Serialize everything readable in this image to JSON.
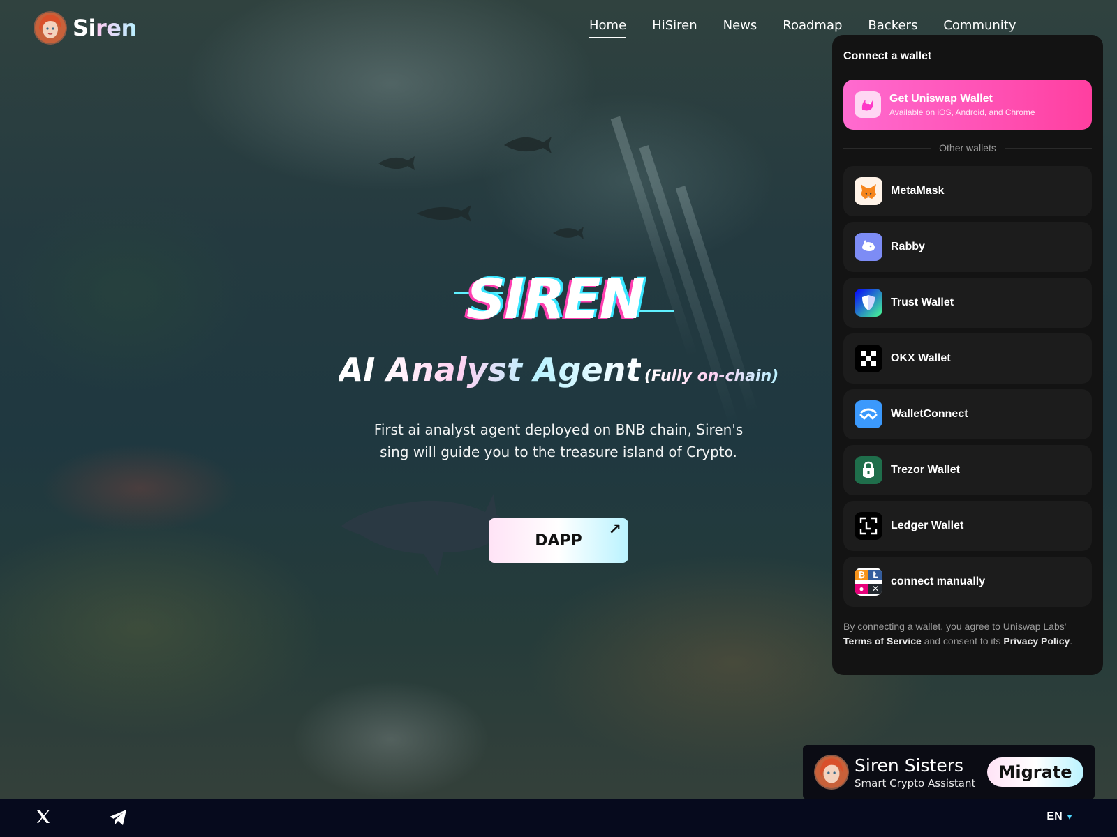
{
  "brand": {
    "name_start": "Si",
    "name_end": "ren"
  },
  "nav": {
    "items": [
      {
        "label": "Home",
        "active": true
      },
      {
        "label": "HiSiren",
        "active": false
      },
      {
        "label": "News",
        "active": false
      },
      {
        "label": "Roadmap",
        "active": false
      },
      {
        "label": "Backers",
        "active": false
      },
      {
        "label": "Community",
        "active": false
      }
    ]
  },
  "hero": {
    "logo_text": "SIREN",
    "title": "AI Analyst Agent",
    "title_suffix": "(Fully on-chain)",
    "description": "First ai analyst agent deployed on BNB chain, Siren's sing will guide you to the treasure island of Crypto.",
    "cta_label": "DAPP",
    "cta_icon": "arrow-up-right-icon"
  },
  "wallet_modal": {
    "title": "Connect a wallet",
    "featured": {
      "name": "Get Uniswap Wallet",
      "subtitle": "Available on iOS, Android, and Chrome",
      "icon": "uniswap-icon"
    },
    "divider_label": "Other wallets",
    "wallets": [
      {
        "name": "MetaMask",
        "icon": "metamask-icon"
      },
      {
        "name": "Rabby",
        "icon": "rabby-icon"
      },
      {
        "name": "Trust Wallet",
        "icon": "trust-wallet-icon"
      },
      {
        "name": "OKX Wallet",
        "icon": "okx-icon"
      },
      {
        "name": "WalletConnect",
        "icon": "walletconnect-icon"
      },
      {
        "name": "Trezor Wallet",
        "icon": "trezor-icon"
      },
      {
        "name": "Ledger Wallet",
        "icon": "ledger-icon"
      },
      {
        "name": "connect manually",
        "icon": "multi-coin-icon"
      }
    ],
    "terms": {
      "prefix": "By connecting a wallet, you agree to Uniswap Labs'",
      "tos_label": "Terms of Service",
      "middle": "and consent to its",
      "privacy_label": "Privacy Policy",
      "suffix": "."
    }
  },
  "promo": {
    "name": "Siren Sisters",
    "subtitle": "Smart Crypto Assistant",
    "button_label": "Migrate"
  },
  "footer": {
    "social": [
      "x-icon",
      "telegram-icon"
    ],
    "language": "EN"
  },
  "colors": {
    "accent_pink": "#ff3fb0",
    "accent_cyan": "#38e6ff",
    "panel_bg": "#131313",
    "footer_bg": "#060a1d"
  }
}
